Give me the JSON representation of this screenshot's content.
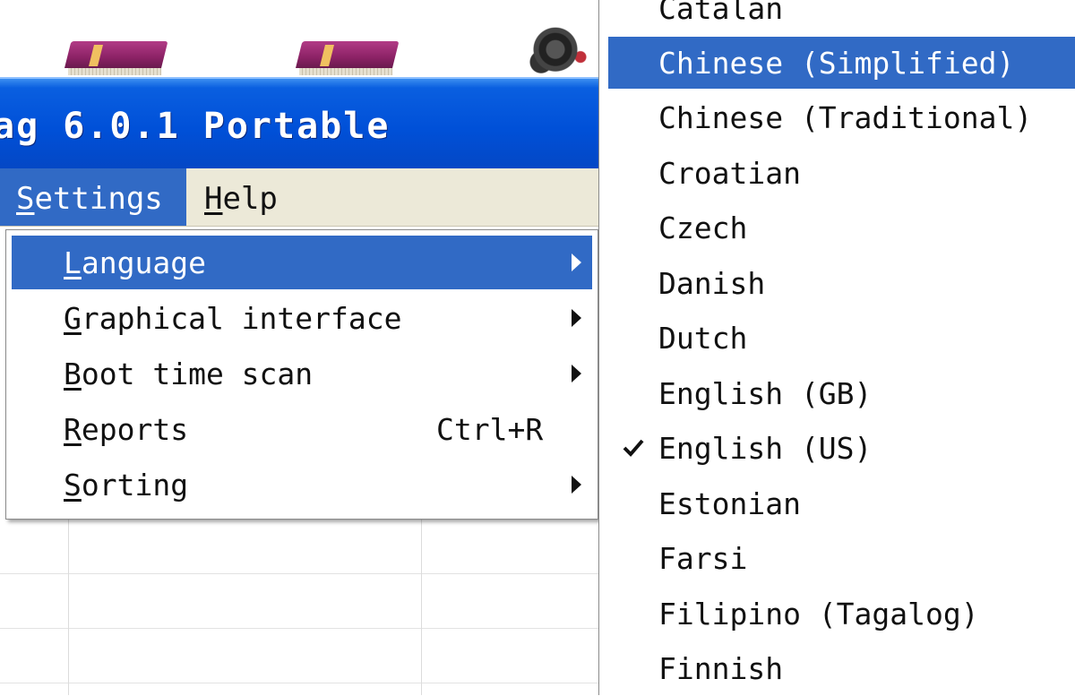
{
  "window": {
    "title": "ag 6.0.1 Portable"
  },
  "menubar": {
    "items": [
      {
        "label": "Settings",
        "mnemonic": "S",
        "rest": "ettings",
        "active": true
      },
      {
        "label": "Help",
        "mnemonic": "H",
        "rest": "elp",
        "active": false
      }
    ]
  },
  "settings_menu": {
    "items": [
      {
        "pre": "",
        "mnemonic": "L",
        "rest": "anguage",
        "shortcut": "",
        "submenu": true,
        "highlighted": true
      },
      {
        "pre": "",
        "mnemonic": "G",
        "rest": "raphical interface",
        "shortcut": "",
        "submenu": true,
        "highlighted": false
      },
      {
        "pre": "",
        "mnemonic": "B",
        "rest": "oot time scan",
        "shortcut": "",
        "submenu": true,
        "highlighted": false
      },
      {
        "pre": "",
        "mnemonic": "R",
        "rest": "eports",
        "shortcut": "Ctrl+R",
        "submenu": false,
        "highlighted": false
      },
      {
        "pre": "",
        "mnemonic": "S",
        "rest": "orting",
        "shortcut": "",
        "submenu": true,
        "highlighted": false
      }
    ]
  },
  "language_menu": {
    "items": [
      {
        "label": "Catalan",
        "checked": false,
        "highlighted": false
      },
      {
        "label": "Chinese (Simplified)",
        "checked": false,
        "highlighted": true
      },
      {
        "label": "Chinese (Traditional)",
        "checked": false,
        "highlighted": false
      },
      {
        "label": "Croatian",
        "checked": false,
        "highlighted": false
      },
      {
        "label": "Czech",
        "checked": false,
        "highlighted": false
      },
      {
        "label": "Danish",
        "checked": false,
        "highlighted": false
      },
      {
        "label": "Dutch",
        "checked": false,
        "highlighted": false
      },
      {
        "label": "English (GB)",
        "checked": false,
        "highlighted": false
      },
      {
        "label": "English (US)",
        "checked": true,
        "highlighted": false
      },
      {
        "label": "Estonian",
        "checked": false,
        "highlighted": false
      },
      {
        "label": "Farsi",
        "checked": false,
        "highlighted": false
      },
      {
        "label": "Filipino (Tagalog)",
        "checked": false,
        "highlighted": false
      },
      {
        "label": "Finnish",
        "checked": false,
        "highlighted": false
      }
    ]
  },
  "colors": {
    "highlight": "#316ac5",
    "titlebar": "#0050d8",
    "menubar": "#ece9d8"
  }
}
